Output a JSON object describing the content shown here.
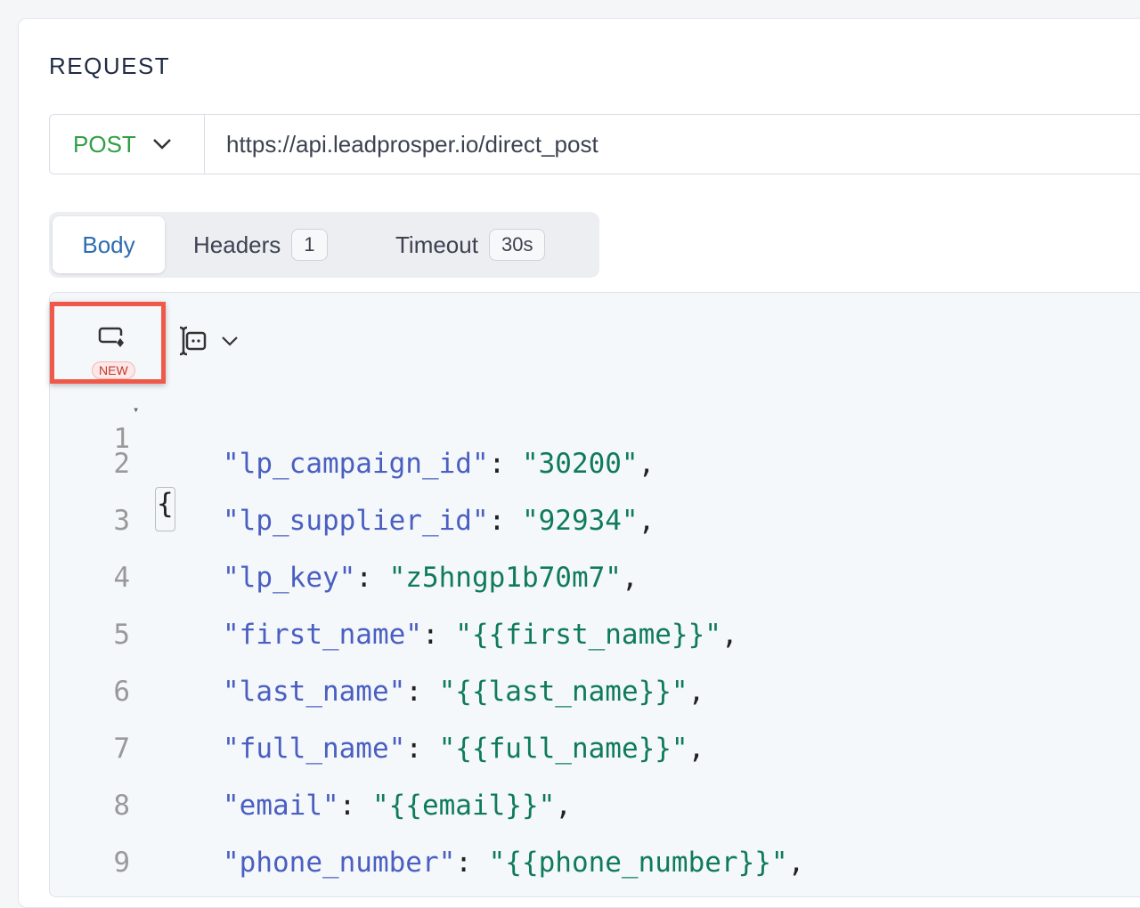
{
  "section_title": "REQUEST",
  "request": {
    "method": "POST",
    "url": "https://api.leadprosper.io/direct_post"
  },
  "tabs": [
    {
      "label": "Body",
      "active": true
    },
    {
      "label": "Headers",
      "badge": "1"
    },
    {
      "label": "Timeout",
      "badge": "30s"
    }
  ],
  "toolbar": {
    "new_badge": "NEW",
    "highlight_color": "#f0584a"
  },
  "code_lines": [
    {
      "n": "1",
      "open": "{"
    },
    {
      "n": "2",
      "key": "\"lp_campaign_id\"",
      "value": "\"30200\""
    },
    {
      "n": "3",
      "key": "\"lp_supplier_id\"",
      "value": "\"92934\""
    },
    {
      "n": "4",
      "key": "\"lp_key\"",
      "value": "\"z5hngp1b70m7\""
    },
    {
      "n": "5",
      "key": "\"first_name\"",
      "value": "\"{{first_name}}\""
    },
    {
      "n": "6",
      "key": "\"last_name\"",
      "value": "\"{{last_name}}\""
    },
    {
      "n": "7",
      "key": "\"full_name\"",
      "value": "\"{{full_name}}\""
    },
    {
      "n": "8",
      "key": "\"email\"",
      "value": "\"{{email}}\""
    },
    {
      "n": "9",
      "key": "\"phone_number\"",
      "value": "\"{{phone_number}}\""
    }
  ]
}
